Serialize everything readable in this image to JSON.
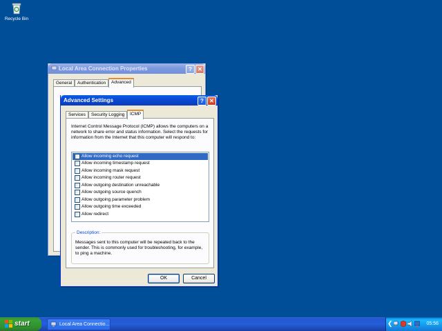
{
  "desktop": {
    "icons": [
      {
        "label": "Recycle Bin",
        "icon": "recycle-bin-icon"
      }
    ]
  },
  "lan_properties": {
    "title": "Local Area Connection Properties",
    "tabs": [
      "General",
      "Authentication",
      "Advanced"
    ],
    "selected_tab": "Advanced"
  },
  "advanced_settings": {
    "title": "Advanced Settings",
    "tabs": [
      "Services",
      "Security Logging",
      "ICMP"
    ],
    "selected_tab": "ICMP",
    "intro": "Internet Control Message Protocol (ICMP) allows the computers on a network to share error and status information. Select the requests for information from the Internet that this computer will respond to:",
    "requests": [
      {
        "label": "Allow incoming echo request",
        "checked": false,
        "selected": true
      },
      {
        "label": "Allow incoming timestamp request",
        "checked": false
      },
      {
        "label": "Allow incoming mask request",
        "checked": false
      },
      {
        "label": "Allow incoming router request",
        "checked": false
      },
      {
        "label": "Allow outgoing destination unreachable",
        "checked": false
      },
      {
        "label": "Allow outgoing source quench",
        "checked": false
      },
      {
        "label": "Allow outgoing parameter problem",
        "checked": false
      },
      {
        "label": "Allow outgoing time exceeded",
        "checked": false
      },
      {
        "label": "Allow redirect",
        "checked": false
      }
    ],
    "description_label": "Description:",
    "description": "Messages sent to this computer will be repeated back to the sender. This is commonly used for troubleshooting, for example, to ping a machine.",
    "ok_label": "OK",
    "cancel_label": "Cancel"
  },
  "taskbar": {
    "start_label": "start",
    "task_label": "Local Area Connectio...",
    "clock": "05:56"
  },
  "colors": {
    "desktop": "#004e98",
    "title_active": "#0a47d4",
    "selection": "#316ac5",
    "start_green": "#36a336"
  }
}
